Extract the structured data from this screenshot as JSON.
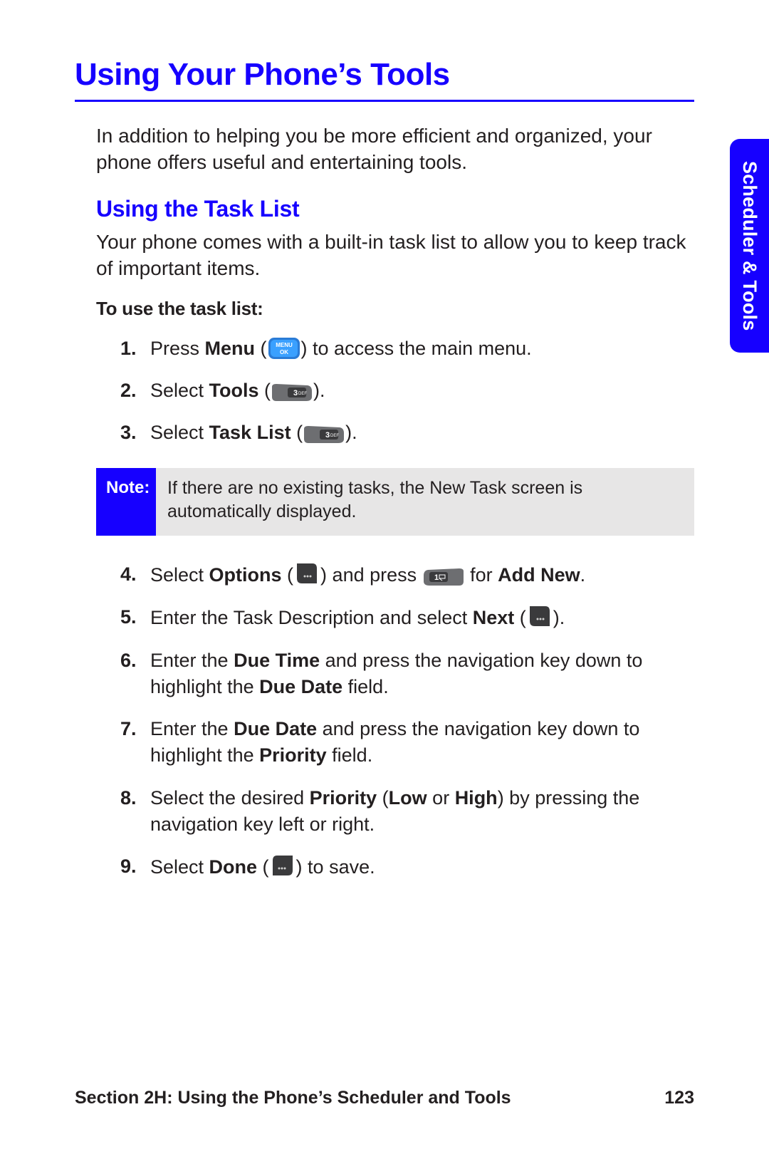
{
  "side_tab": "Scheduler & Tools",
  "title": "Using Your Phone’s Tools",
  "intro": "In addition to helping you be more efficient and organized, your phone offers useful and entertaining tools.",
  "subhead": "Using the Task List",
  "subhead_body": "Your phone comes with a built-in task list to allow you to keep track of important items.",
  "lead_in": "To use the task list:",
  "steps": {
    "s1": {
      "pre": "Press ",
      "bold1": "Menu",
      "post": " to access the main menu."
    },
    "s2": {
      "pre": "Select ",
      "bold1": "Tools",
      "post": "."
    },
    "s3": {
      "pre": "Select ",
      "bold1": "Task List",
      "post": "."
    },
    "s4": {
      "pre": "Select ",
      "bold1": "Options",
      "mid": " and press ",
      "post_pre": " for ",
      "bold2": "Add New",
      "post": "."
    },
    "s5": {
      "pre": "Enter the Task Description and select ",
      "bold1": "Next",
      "post": "."
    },
    "s6": {
      "pre": "Enter the ",
      "bold1": "Due Time",
      "mid": " and press the navigation key down to highlight the ",
      "bold2": "Due Date",
      "post": " field."
    },
    "s7": {
      "pre": "Enter the ",
      "bold1": "Due Date",
      "mid": " and press the navigation key down to highlight the ",
      "bold2": "Priority",
      "post": " field."
    },
    "s8": {
      "pre": "Select the desired ",
      "bold1": "Priority",
      "mid": " (",
      "bold2": "Low",
      "mid2": " or ",
      "bold3": "High",
      "post": ") by pressing the navigation key left or right."
    },
    "s9": {
      "pre": "Select ",
      "bold1": "Done",
      "post": " to save."
    }
  },
  "note": {
    "label": "Note:",
    "body": "If there are no existing tasks, the New Task screen is automatically displayed."
  },
  "footer": {
    "section": "Section 2H: Using the Phone’s Scheduler and Tools",
    "page": "123"
  }
}
